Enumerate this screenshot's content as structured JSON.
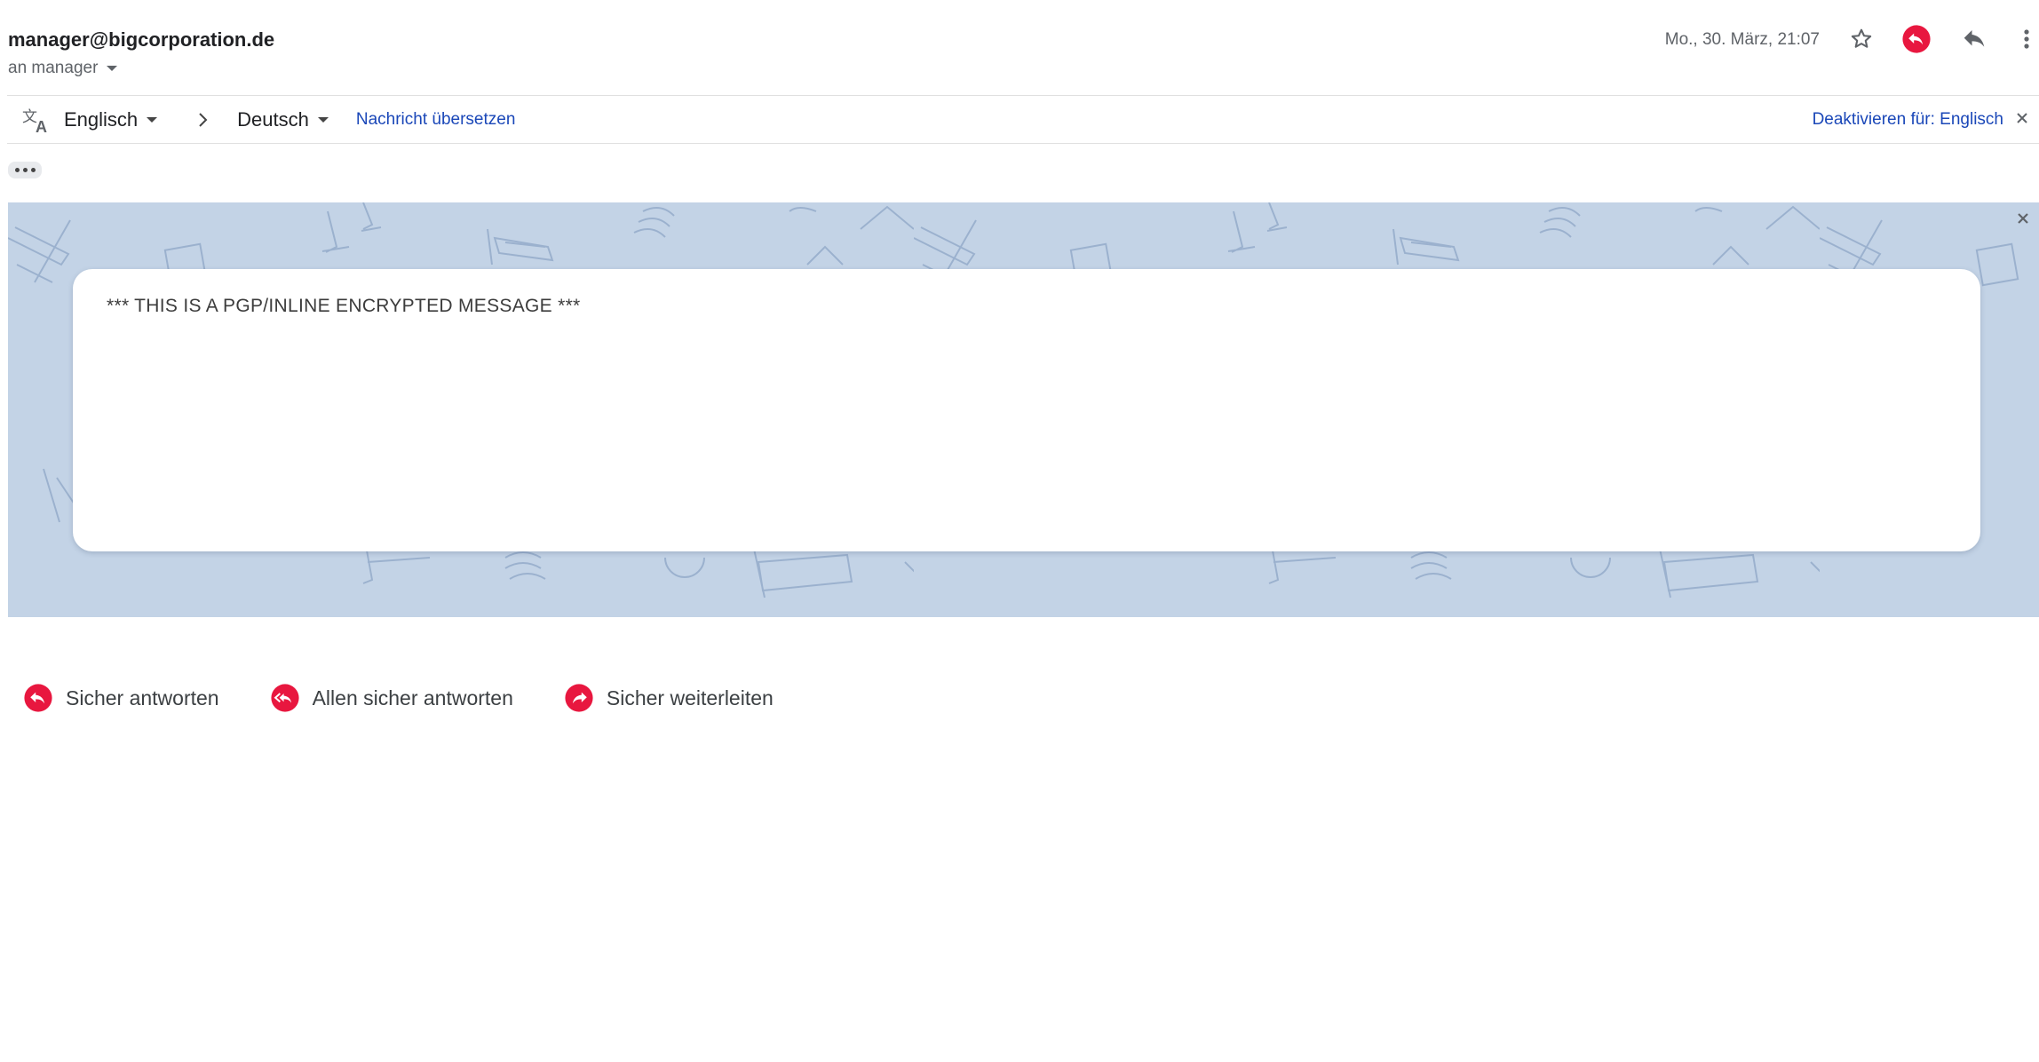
{
  "header": {
    "sender": "manager@bigcorporation.de",
    "recipient": "an manager",
    "date": "Mo., 30. März, 21:07"
  },
  "translate_bar": {
    "source_language": "Englisch",
    "target_language": "Deutsch",
    "translate_link": "Nachricht übersetzen",
    "deactivate_link": "Deaktivieren für: Englisch"
  },
  "encrypted_frame": {
    "message": "*** THIS IS A PGP/INLINE ENCRYPTED MESSAGE ***"
  },
  "actions": {
    "reply": "Sicher antworten",
    "reply_all": "Allen sicher antworten",
    "forward": "Sicher weiterleiten"
  },
  "colors": {
    "accent_red": "#e8173f",
    "link_blue": "#1a47b8",
    "frame_background": "#c3d3e6"
  },
  "icons": {
    "header": [
      "star-icon",
      "secure-reply-icon",
      "reply-icon",
      "more-vert-icon"
    ],
    "translate": "translate-icon",
    "actions": [
      "reply-icon",
      "reply-all-icon",
      "forward-icon"
    ]
  }
}
